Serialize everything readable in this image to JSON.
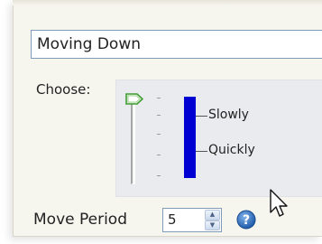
{
  "form": {
    "name_value": "Moving Down",
    "choose_label": "Choose:",
    "speed_levels": [
      "Slowly",
      "Quickly"
    ],
    "slider_position": 0.0,
    "move_period_label": "Move Period",
    "move_period_value": "5"
  },
  "icons": {
    "slider_thumb": "slider-thumb-icon",
    "spin_up": "chevron-up-icon",
    "spin_down": "chevron-down-icon",
    "help": "help-question-icon",
    "cursor": "mouse-pointer-icon"
  },
  "colors": {
    "indicator": "#0000d2",
    "help": "#2f6db5",
    "panel": "#e9ebee",
    "frame": "#f6f5ee"
  }
}
